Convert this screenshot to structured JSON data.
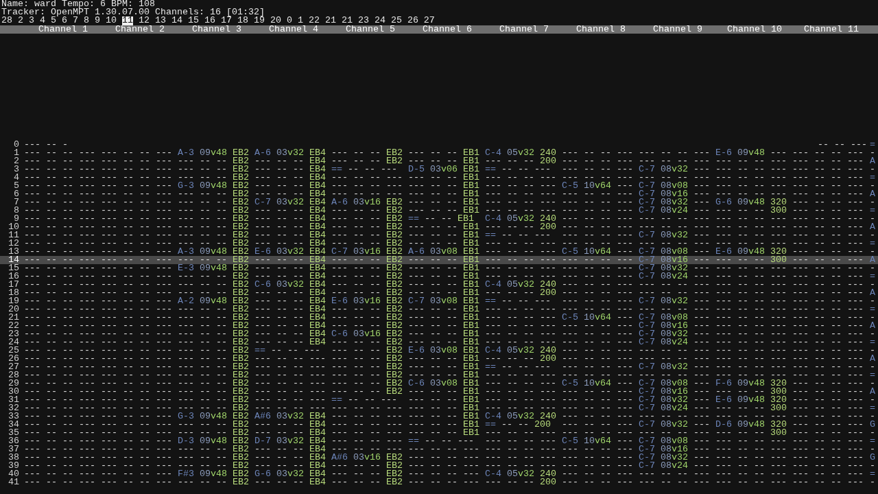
{
  "info": {
    "name_line": "Name: ward Tempo: 6 BPM: 108",
    "tracker_line": "Tracker: OpenMPT 1.30.07.00 Channels: 16 [01:32]"
  },
  "orders": {
    "before": "28 2 3 4 5 6 7 8 9 10",
    "current": "11",
    "after": "12 13 14 15 16 17 18 19 20 0 1 22 21 21 23 24 25 26 27"
  },
  "channels": [
    "Channel 1",
    "Channel 2",
    "Channel 3",
    "Channel 4",
    "Channel 5",
    "Channel 6",
    "Channel 7",
    "Channel 8",
    "Channel 9",
    "Channel 10",
    "Channel 11"
  ],
  "rows": [
    {
      "kind": "partial",
      "num": "0",
      "selected": false,
      "head": "--- -- -",
      "tail": "-- -- ---",
      "edge": "="
    },
    {
      "kind": "full",
      "num": "1",
      "selected": false,
      "cells": [
        "--- -- -- ---",
        "--- -- -- ---",
        "A-3 09v48 EB2",
        "A-6 03v32 EB4",
        "--- -- -- EB2",
        "--- -- -- EB1",
        "C-4 05v32 240",
        "--- -- -- ---",
        "--- -- -- ---",
        "E-6 09v48 ---",
        "--- -- -- ---"
      ],
      "edge": "-"
    },
    {
      "kind": "full",
      "num": "2",
      "selected": false,
      "cells": [
        "--- -- -- ---",
        "--- -- -- ---",
        "--- -- -- EB2",
        "--- -- -- EB4",
        "--- -- -- EB2",
        "--- -- -- EB1",
        "--- -- -- 200",
        "--- -- -- ---",
        "--- -- -- ---",
        "--- -- -- ---",
        "--- -- -- ---"
      ],
      "edge": "A"
    },
    {
      "kind": "full",
      "num": "3",
      "selected": false,
      "cells": [
        "--- -- -- ---",
        "--- -- -- ---",
        "--- -- -- EB2",
        "--- -- -- EB4",
        "== -- -- ---",
        "D-5 03v06 EB1",
        "== -- -- ---",
        "--- -- -- ---",
        "C-7 08v32 ---",
        "--- -- -- ---",
        "--- -- -- ---"
      ],
      "edge": "-"
    },
    {
      "kind": "full",
      "num": "4",
      "selected": false,
      "cells": [
        "--- -- -- ---",
        "--- -- -- ---",
        "--- -- -- EB2",
        "--- -- -- EB4",
        "--- -- -- ---",
        "--- -- -- EB1",
        "--- -- -- ---",
        "--- -- -- ---",
        "--- -- -- ---",
        "--- -- -- ---",
        "--- -- -- ---"
      ],
      "edge": "="
    },
    {
      "kind": "full",
      "num": "5",
      "selected": false,
      "cells": [
        "--- -- -- ---",
        "--- -- -- ---",
        "G-3 09v48 EB2",
        "--- -- -- EB4",
        "--- -- -- ---",
        "--- -- -- EB1",
        "--- -- -- ---",
        "C-5 10v64 ---",
        "C-7 08v08 ---",
        "--- -- -- ---",
        "--- -- -- ---"
      ],
      "edge": "-"
    },
    {
      "kind": "full",
      "num": "6",
      "selected": false,
      "cells": [
        "--- -- -- ---",
        "--- -- -- ---",
        "--- -- -- EB2",
        "--- -- -- EB4",
        "--- -- -- ---",
        "--- -- -- EB1",
        "--- -- -- ---",
        "--- -- -- ---",
        "C-7 08v16 ---",
        "--- -- -- ---",
        "--- -- -- ---"
      ],
      "edge": "A"
    },
    {
      "kind": "full",
      "num": "7",
      "selected": false,
      "cells": [
        "--- -- -- ---",
        "--- -- -- ---",
        "--- -- -- EB2",
        "C-7 03v32 EB4",
        "A-6 03v16 EB2",
        "--- -- -- EB1",
        "--- -- -- ---",
        "--- -- -- ---",
        "C-7 08v32 ---",
        "G-6 09v48 320",
        "--- -- -- ---"
      ],
      "edge": "-"
    },
    {
      "kind": "full",
      "num": "8",
      "selected": false,
      "cells": [
        "--- -- -- ---",
        "--- -- -- ---",
        "--- -- -- EB2",
        "--- -- -- EB4",
        "--- -- -- EB2",
        "--- -- -- EB1",
        "--- -- -- ---",
        "--- -- -- ---",
        "C-7 08v24 ---",
        "--- -- -- 300",
        "--- -- -- ---"
      ],
      "edge": "="
    },
    {
      "kind": "full",
      "num": "9",
      "selected": false,
      "cells": [
        "--- -- -- ---",
        "--- -- -- ---",
        "--- -- -- EB2",
        "--- -- -- EB4",
        "--- -- -- EB2",
        "== -- -- EB1",
        "C-4 05v32 240",
        "--- -- -- ---",
        "--- -- -- ---",
        "--- -- -- ---",
        "--- -- -- ---"
      ],
      "edge": "-"
    },
    {
      "kind": "full",
      "num": "10",
      "selected": false,
      "cells": [
        "--- -- -- ---",
        "--- -- -- ---",
        "--- -- -- EB2",
        "--- -- -- EB4",
        "--- -- -- EB2",
        "--- -- -- EB1",
        "--- -- -- 200",
        "--- -- -- ---",
        "--- -- -- ---",
        "--- -- -- ---",
        "--- -- -- ---"
      ],
      "edge": "A"
    },
    {
      "kind": "full",
      "num": "11",
      "selected": false,
      "cells": [
        "--- -- -- ---",
        "--- -- -- ---",
        "--- -- -- EB2",
        "--- -- -- EB4",
        "--- -- -- EB2",
        "--- -- -- EB1",
        "== -- -- ---",
        "--- -- -- ---",
        "C-7 08v32 ---",
        "--- -- -- ---",
        "--- -- -- ---"
      ],
      "edge": "-"
    },
    {
      "kind": "full",
      "num": "12",
      "selected": false,
      "cells": [
        "--- -- -- ---",
        "--- -- -- ---",
        "--- -- -- EB2",
        "--- -- -- EB4",
        "--- -- -- EB2",
        "--- -- -- EB1",
        "--- -- -- ---",
        "--- -- -- ---",
        "--- -- -- ---",
        "--- -- -- ---",
        "--- -- -- ---"
      ],
      "edge": "="
    },
    {
      "kind": "full",
      "num": "13",
      "selected": false,
      "cells": [
        "--- -- -- ---",
        "--- -- -- ---",
        "A-3 09v48 EB2",
        "E-6 03v32 EB4",
        "C-7 03v16 EB2",
        "A-6 03v08 EB1",
        "--- -- -- ---",
        "C-5 10v64 ---",
        "C-7 08v08 ---",
        "E-6 09v48 320",
        "--- -- -- ---"
      ],
      "edge": "-"
    },
    {
      "kind": "full",
      "num": "14",
      "selected": true,
      "cells": [
        "--- -- -- ---",
        "--- -- -- ---",
        "--- -- -- EB2",
        "--- -- -- EB4",
        "--- -- -- EB2",
        "--- -- -- EB1",
        "--- -- -- ---",
        "--- -- -- ---",
        "C-7 08v16 ---",
        "--- -- -- 300",
        "--- -- -- ---"
      ],
      "edge": "A"
    },
    {
      "kind": "full",
      "num": "15",
      "selected": false,
      "cells": [
        "--- -- -- ---",
        "--- -- -- ---",
        "E-3 09v48 EB2",
        "--- -- -- EB4",
        "--- -- -- EB2",
        "--- -- -- EB1",
        "--- -- -- ---",
        "--- -- -- ---",
        "C-7 08v32 ---",
        "--- -- -- ---",
        "--- -- -- ---"
      ],
      "edge": "-"
    },
    {
      "kind": "full",
      "num": "16",
      "selected": false,
      "cells": [
        "--- -- -- ---",
        "--- -- -- ---",
        "--- -- -- EB2",
        "--- -- -- EB4",
        "--- -- -- EB2",
        "--- -- -- EB1",
        "--- -- -- ---",
        "--- -- -- ---",
        "C-7 08v24 ---",
        "--- -- -- ---",
        "--- -- -- ---"
      ],
      "edge": "="
    },
    {
      "kind": "full",
      "num": "17",
      "selected": false,
      "cells": [
        "--- -- -- ---",
        "--- -- -- ---",
        "--- -- -- EB2",
        "C-6 03v32 EB4",
        "--- -- -- EB2",
        "--- -- -- EB1",
        "C-4 05v32 240",
        "--- -- -- ---",
        "--- -- -- ---",
        "--- -- -- ---",
        "--- -- -- ---"
      ],
      "edge": "-"
    },
    {
      "kind": "full",
      "num": "18",
      "selected": false,
      "cells": [
        "--- -- -- ---",
        "--- -- -- ---",
        "--- -- -- EB2",
        "--- -- -- EB4",
        "--- -- -- EB2",
        "--- -- -- EB1",
        "--- -- -- 200",
        "--- -- -- ---",
        "--- -- -- ---",
        "--- -- -- ---",
        "--- -- -- ---"
      ],
      "edge": "A"
    },
    {
      "kind": "full",
      "num": "19",
      "selected": false,
      "cells": [
        "--- -- -- ---",
        "--- -- -- ---",
        "A-2 09v48 EB2",
        "--- -- -- EB4",
        "E-6 03v16 EB2",
        "C-7 03v08 EB1",
        "== -- -- ---",
        "--- -- -- ---",
        "C-7 08v32 ---",
        "--- -- -- ---",
        "--- -- -- ---"
      ],
      "edge": "-"
    },
    {
      "kind": "full",
      "num": "20",
      "selected": false,
      "cells": [
        "--- -- -- ---",
        "--- -- -- ---",
        "--- -- -- EB2",
        "--- -- -- EB4",
        "--- -- -- EB2",
        "--- -- -- EB1",
        "--- -- -- ---",
        "--- -- -- ---",
        "--- -- -- ---",
        "--- -- -- ---",
        "--- -- -- ---"
      ],
      "edge": "="
    },
    {
      "kind": "full",
      "num": "21",
      "selected": false,
      "cells": [
        "--- -- -- ---",
        "--- -- -- ---",
        "--- -- -- EB2",
        "--- -- -- EB4",
        "--- -- -- EB2",
        "--- -- -- EB1",
        "--- -- -- ---",
        "C-5 10v64 ---",
        "C-7 08v08 ---",
        "--- -- -- ---",
        "--- -- -- ---"
      ],
      "edge": "-"
    },
    {
      "kind": "full",
      "num": "22",
      "selected": false,
      "cells": [
        "--- -- -- ---",
        "--- -- -- ---",
        "--- -- -- EB2",
        "--- -- -- EB4",
        "--- -- -- EB2",
        "--- -- -- EB1",
        "--- -- -- ---",
        "--- -- -- ---",
        "C-7 08v16 ---",
        "--- -- -- ---",
        "--- -- -- ---"
      ],
      "edge": "A"
    },
    {
      "kind": "full",
      "num": "23",
      "selected": false,
      "cells": [
        "--- -- -- ---",
        "--- -- -- ---",
        "--- -- -- EB2",
        "--- -- -- EB4",
        "C-6 03v16 EB2",
        "--- -- -- EB1",
        "--- -- -- ---",
        "--- -- -- ---",
        "C-7 08v32 ---",
        "--- -- -- ---",
        "--- -- -- ---"
      ],
      "edge": "-"
    },
    {
      "kind": "full",
      "num": "24",
      "selected": false,
      "cells": [
        "--- -- -- ---",
        "--- -- -- ---",
        "--- -- -- EB2",
        "--- -- -- EB4",
        "--- -- -- EB2",
        "--- -- -- EB1",
        "--- -- -- ---",
        "--- -- -- ---",
        "C-7 08v24 ---",
        "--- -- -- ---",
        "--- -- -- ---"
      ],
      "edge": "="
    },
    {
      "kind": "full",
      "num": "25",
      "selected": false,
      "cells": [
        "--- -- -- ---",
        "--- -- -- ---",
        "--- -- -- EB2",
        "== -- -- ---",
        "--- -- -- EB2",
        "E-6 03v08 EB1",
        "C-4 05v32 240",
        "--- -- -- ---",
        "--- -- -- ---",
        "--- -- -- ---",
        "--- -- -- ---"
      ],
      "edge": "-"
    },
    {
      "kind": "full",
      "num": "26",
      "selected": false,
      "cells": [
        "--- -- -- ---",
        "--- -- -- ---",
        "--- -- -- EB2",
        "--- -- -- ---",
        "--- -- -- EB2",
        "--- -- -- EB1",
        "--- -- -- 200",
        "--- -- -- ---",
        "--- -- -- ---",
        "--- -- -- ---",
        "--- -- -- ---"
      ],
      "edge": "A"
    },
    {
      "kind": "full",
      "num": "27",
      "selected": false,
      "cells": [
        "--- -- -- ---",
        "--- -- -- ---",
        "--- -- -- EB2",
        "--- -- -- ---",
        "--- -- -- EB2",
        "--- -- -- EB1",
        "== -- -- ---",
        "--- -- -- ---",
        "C-7 08v32 ---",
        "--- -- -- ---",
        "--- -- -- ---"
      ],
      "edge": "-"
    },
    {
      "kind": "full",
      "num": "28",
      "selected": false,
      "cells": [
        "--- -- -- ---",
        "--- -- -- ---",
        "--- -- -- EB2",
        "--- -- -- ---",
        "--- -- -- EB2",
        "--- -- -- EB1",
        "--- -- -- ---",
        "--- -- -- ---",
        "--- -- -- ---",
        "--- -- -- ---",
        "--- -- -- ---"
      ],
      "edge": "="
    },
    {
      "kind": "full",
      "num": "29",
      "selected": false,
      "cells": [
        "--- -- -- ---",
        "--- -- -- ---",
        "--- -- -- EB2",
        "--- -- -- ---",
        "--- -- -- EB2",
        "C-6 03v08 EB1",
        "--- -- -- ---",
        "C-5 10v64 ---",
        "C-7 08v08 ---",
        "F-6 09v48 320",
        "--- -- -- ---"
      ],
      "edge": "-"
    },
    {
      "kind": "full",
      "num": "30",
      "selected": false,
      "cells": [
        "--- -- -- ---",
        "--- -- -- ---",
        "--- -- -- EB2",
        "--- -- -- ---",
        "--- -- -- EB2",
        "--- -- -- EB1",
        "--- -- -- ---",
        "--- -- -- ---",
        "C-7 08v16 ---",
        "--- -- -- 300",
        "--- -- -- ---"
      ],
      "edge": "A"
    },
    {
      "kind": "full",
      "num": "31",
      "selected": false,
      "cells": [
        "--- -- -- ---",
        "--- -- -- ---",
        "--- -- -- EB2",
        "--- -- -- ---",
        "== -- -- ---",
        "--- -- -- EB1",
        "--- -- -- ---",
        "--- -- -- ---",
        "C-7 08v32 ---",
        "E-6 09v48 320",
        "--- -- -- ---"
      ],
      "edge": "-"
    },
    {
      "kind": "full",
      "num": "32",
      "selected": false,
      "cells": [
        "--- -- -- ---",
        "--- -- -- ---",
        "--- -- -- EB2",
        "--- -- -- ---",
        "--- -- -- ---",
        "--- -- -- EB1",
        "--- -- -- ---",
        "--- -- -- ---",
        "C-7 08v24 ---",
        "--- -- -- 300",
        "--- -- -- ---"
      ],
      "edge": "="
    },
    {
      "kind": "full",
      "num": "33",
      "selected": false,
      "cells": [
        "--- -- -- ---",
        "--- -- -- ---",
        "G-3 09v48 EB2",
        "A#6 03v32 EB4",
        "--- -- -- ---",
        "--- -- -- EB1",
        "C-4 05v32 240",
        "--- -- -- ---",
        "--- -- -- ---",
        "--- -- -- ---",
        "--- -- -- ---"
      ],
      "edge": "-"
    },
    {
      "kind": "full",
      "num": "34",
      "selected": false,
      "cells": [
        "--- -- -- ---",
        "--- -- -- ---",
        "--- -- -- EB2",
        "--- -- -- EB4",
        "--- -- -- ---",
        "--- -- -- EB1",
        "== -- -- 200",
        "--- -- -- ---",
        "C-7 08v32 ---",
        "D-6 09v48 320",
        "--- -- -- ---"
      ],
      "edge": "G"
    },
    {
      "kind": "full",
      "num": "35",
      "selected": false,
      "cells": [
        "--- -- -- ---",
        "--- -- -- ---",
        "--- -- -- EB2",
        "--- -- -- EB4",
        "--- -- -- ---",
        "--- -- -- EB1",
        "--- -- -- ---",
        "--- -- -- ---",
        "--- -- -- ---",
        "--- -- -- 300",
        "--- -- -- ---"
      ],
      "edge": "-"
    },
    {
      "kind": "full",
      "num": "36",
      "selected": false,
      "cells": [
        "--- -- -- ---",
        "--- -- -- ---",
        "D-3 09v48 EB2",
        "D-7 03v32 EB4",
        "--- -- -- ---",
        "== -- -- ---",
        "--- -- -- ---",
        "C-5 10v64 ---",
        "C-7 08v08 ---",
        "--- -- -- ---",
        "--- -- -- ---"
      ],
      "edge": "="
    },
    {
      "kind": "full",
      "num": "37",
      "selected": false,
      "cells": [
        "--- -- -- ---",
        "--- -- -- ---",
        "--- -- -- EB2",
        "--- -- -- EB4",
        "--- -- -- ---",
        "--- -- -- ---",
        "--- -- -- ---",
        "--- -- -- ---",
        "C-7 08v16 ---",
        "--- -- -- ---",
        "--- -- -- ---"
      ],
      "edge": "-"
    },
    {
      "kind": "full",
      "num": "38",
      "selected": false,
      "cells": [
        "--- -- -- ---",
        "--- -- -- ---",
        "--- -- -- EB2",
        "--- -- -- EB4",
        "A#6 03v16 EB2",
        "--- -- -- ---",
        "--- -- -- ---",
        "--- -- -- ---",
        "C-7 08v32 ---",
        "--- -- -- ---",
        "--- -- -- ---"
      ],
      "edge": "G"
    },
    {
      "kind": "full",
      "num": "39",
      "selected": false,
      "cells": [
        "--- -- -- ---",
        "--- -- -- ---",
        "--- -- -- EB2",
        "--- -- -- EB4",
        "--- -- -- EB2",
        "--- -- -- ---",
        "--- -- -- ---",
        "--- -- -- ---",
        "C-7 08v24 ---",
        "--- -- -- ---",
        "--- -- -- ---"
      ],
      "edge": "-"
    },
    {
      "kind": "full",
      "num": "40",
      "selected": false,
      "cells": [
        "--- -- -- ---",
        "--- -- -- ---",
        "F#3 09v48 EB2",
        "G-6 03v32 EB4",
        "--- -- -- EB2",
        "--- -- -- ---",
        "C-4 05v32 240",
        "--- -- -- ---",
        "--- -- -- ---",
        "--- -- -- ---",
        "--- -- -- ---"
      ],
      "edge": "="
    },
    {
      "kind": "full",
      "num": "41",
      "selected": false,
      "cells": [
        "--- -- -- ---",
        "--- -- -- ---",
        "--- -- -- EB2",
        "--- -- -- EB4",
        "--- -- -- EB2",
        "--- -- -- ---",
        "--- -- -- 200",
        "--- -- -- ---",
        "--- -- -- ---",
        "--- -- -- ---",
        "--- -- -- ---"
      ],
      "edge": "-"
    }
  ]
}
